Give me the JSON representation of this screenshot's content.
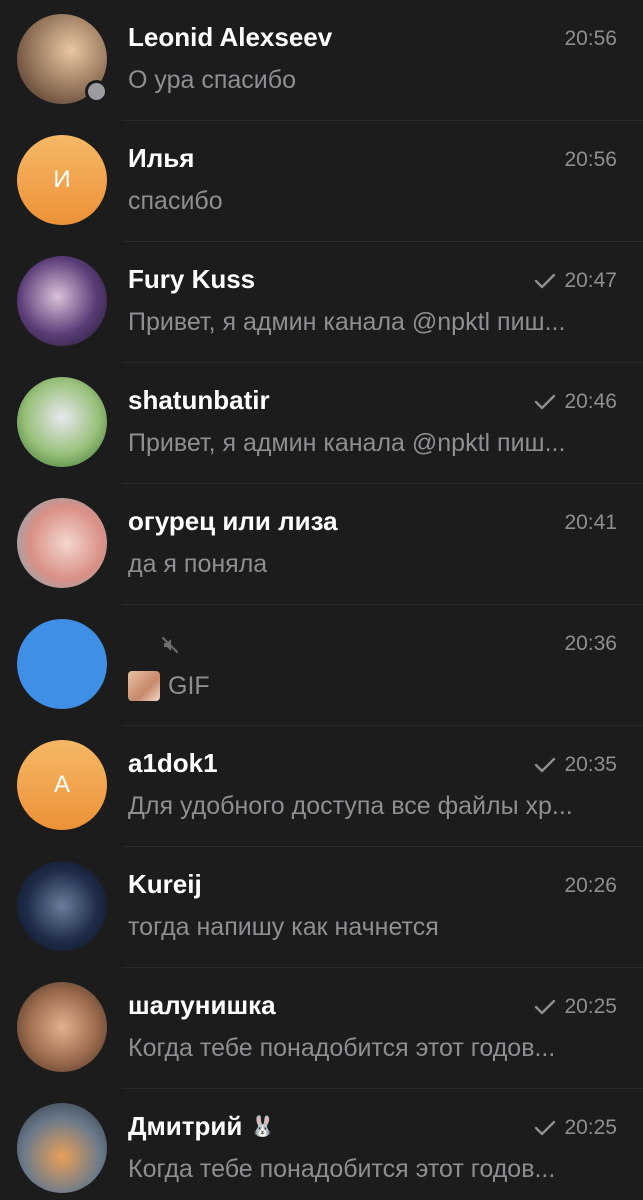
{
  "chats": [
    {
      "name": "Leonid Alexseev",
      "time": "20:56",
      "preview": "О ура спасибо",
      "avatar_letter": "",
      "avatar_bg": "#8a6a52",
      "read_check": false,
      "status_dot": true
    },
    {
      "name": "Илья",
      "time": "20:56",
      "preview": "спасибо",
      "avatar_letter": "И",
      "avatar_bg": "#f0a24a",
      "read_check": false,
      "status_dot": false
    },
    {
      "name": "Fury Kuss",
      "time": "20:47",
      "preview": "Привет, я админ канала @npktl пиш...",
      "avatar_letter": "",
      "avatar_bg": "#3d2f4e",
      "read_check": true,
      "status_dot": false
    },
    {
      "name": "shatunbatir",
      "time": "20:46",
      "preview": "Привет, я админ канала @npktl пиш...",
      "avatar_letter": "",
      "avatar_bg": "#7fb65a",
      "read_check": true,
      "status_dot": false
    },
    {
      "name": "огурец или лиза",
      "time": "20:41",
      "preview": "да я поняла",
      "avatar_letter": "",
      "avatar_bg": "#d99a8f",
      "read_check": false,
      "status_dot": false
    },
    {
      "name": "",
      "time": "20:36",
      "preview": "GIF",
      "avatar_letter": "",
      "avatar_bg": "#3f8fe6",
      "read_check": false,
      "status_dot": false
    },
    {
      "name": "a1dok1",
      "time": "20:35",
      "preview": "Для удобного доступа все файлы хр...",
      "avatar_letter": "A",
      "avatar_bg": "#f0a24a",
      "read_check": true,
      "status_dot": false
    },
    {
      "name": "Kureij",
      "time": "20:26",
      "preview": "тогда напишу как начнется",
      "avatar_letter": "",
      "avatar_bg": "#1f2d4a",
      "read_check": false,
      "status_dot": false
    },
    {
      "name": "шалунишка",
      "time": "20:25",
      "preview": "Когда тебе понадобится этот годов...",
      "avatar_letter": "",
      "avatar_bg": "#9c6b4d",
      "read_check": true,
      "status_dot": false
    },
    {
      "name": "Дмитрий",
      "time": "20:25",
      "preview": "Когда тебе понадобится этот годов...",
      "avatar_letter": "",
      "avatar_bg": "#6a7a8a",
      "read_check": true,
      "status_dot": false
    }
  ],
  "theme": {
    "background": "#1c1c1d",
    "time_color": "#8e8e93",
    "preview_color": "#8e8e93",
    "divider": "#2a2a2c"
  }
}
